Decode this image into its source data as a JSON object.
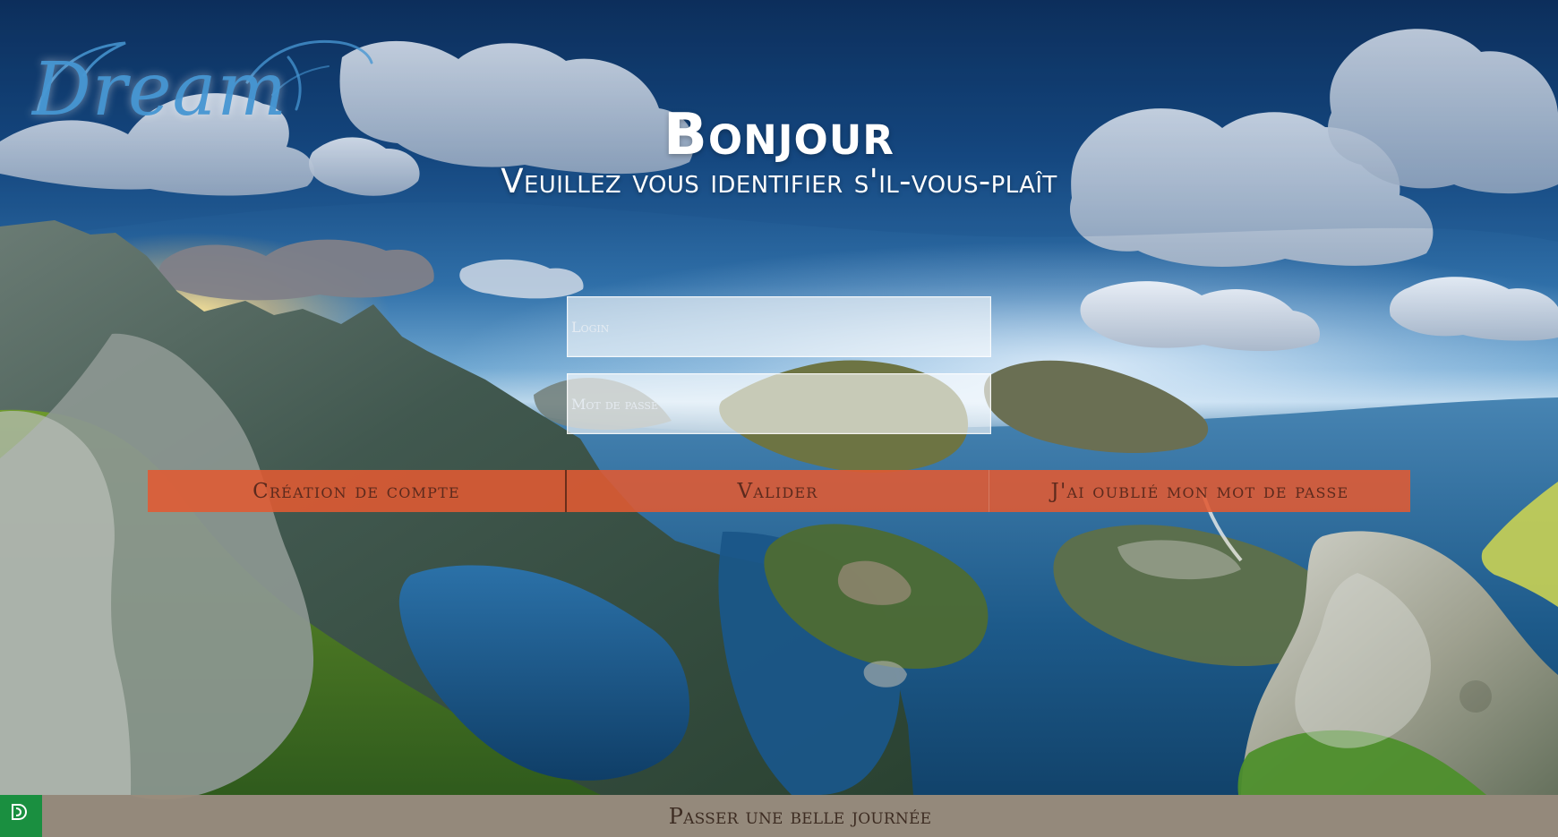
{
  "branding": {
    "logo_text": "Dream",
    "footer_logo_icon": "leaf-d-logo-icon"
  },
  "hero": {
    "title": "Bonjour",
    "subtitle": "Veuillez vous identifier s'il-vous-plaît"
  },
  "form": {
    "login_placeholder": "Login",
    "password_placeholder": "Mot de passe"
  },
  "actions": {
    "create_account": "Création de compte",
    "submit": "Valider",
    "forgot_password": "J'ai oublié mon mot de passe"
  },
  "footer": {
    "message": "Passer une belle journée"
  },
  "colors": {
    "button_bg": "#e15a32",
    "button_text": "#5c2a1d",
    "footer_bg": "#9a8c7c",
    "footer_logo_bg": "#1a8f40",
    "title_text": "#ffffff",
    "logo_text": "#4696d2"
  }
}
